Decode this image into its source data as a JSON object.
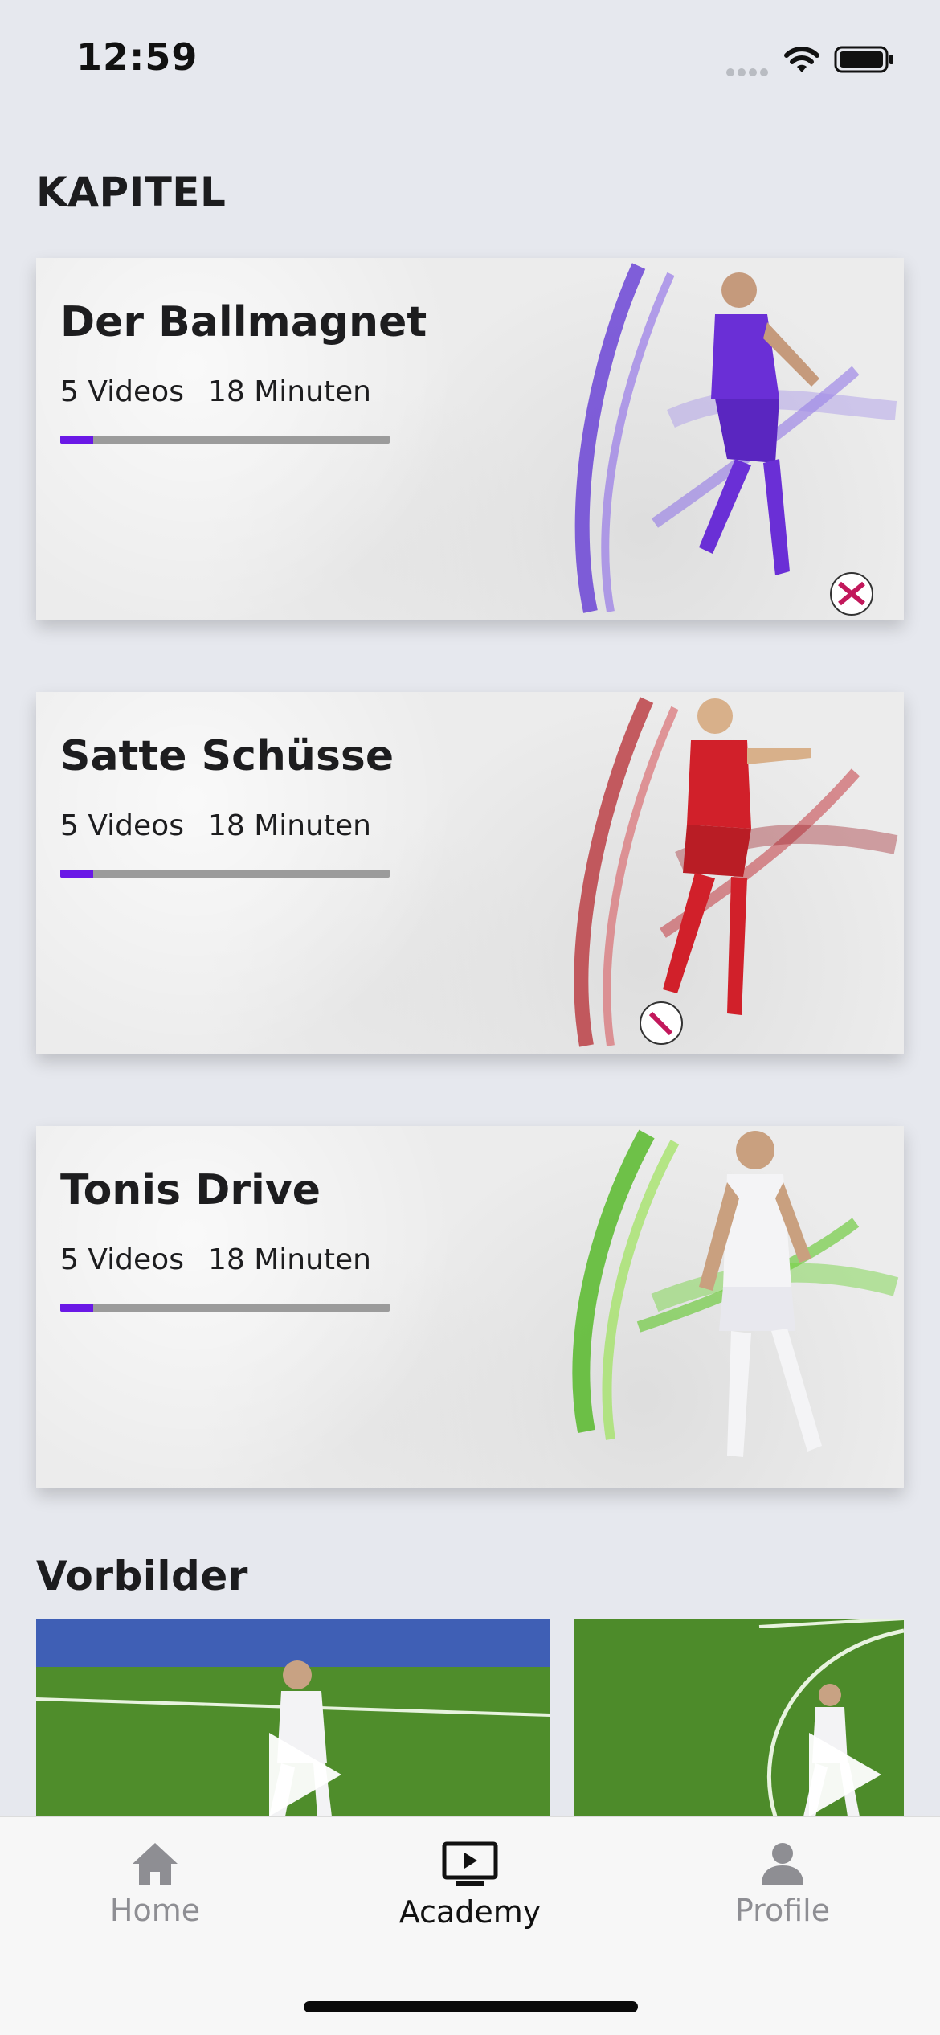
{
  "status_bar": {
    "time": "12:59",
    "icons": [
      "signal-icon",
      "wifi-icon",
      "battery-icon"
    ]
  },
  "chapters_section": {
    "title": "KAPITEL"
  },
  "chapters": [
    {
      "title": "Der Ballmagnet",
      "videos": "5 Videos",
      "duration": "18 Minuten",
      "progress": 0.1,
      "accent": "#6a2fd6"
    },
    {
      "title": "Satte Schüsse",
      "videos": "5 Videos",
      "duration": "18 Minuten",
      "progress": 0.1,
      "accent": "#c0282f"
    },
    {
      "title": "Tonis Drive",
      "videos": "5 Videos",
      "duration": "18 Minuten",
      "progress": 0.1,
      "accent": "#5ec726"
    }
  ],
  "role_models_section": {
    "title": "Vorbilder"
  },
  "role_models": [
    {
      "icon": "play-icon"
    },
    {
      "icon": "play-icon"
    }
  ],
  "tab_bar": {
    "tabs": [
      {
        "label": "Home",
        "icon": "home-icon",
        "active": false
      },
      {
        "label": "Academy",
        "icon": "tv-play-icon",
        "active": true
      },
      {
        "label": "Profile",
        "icon": "person-icon",
        "active": false
      }
    ]
  },
  "colors": {
    "progress_fill": "#6a18e6",
    "progress_track": "#9b9b9b",
    "background": "#e6e8ee"
  }
}
